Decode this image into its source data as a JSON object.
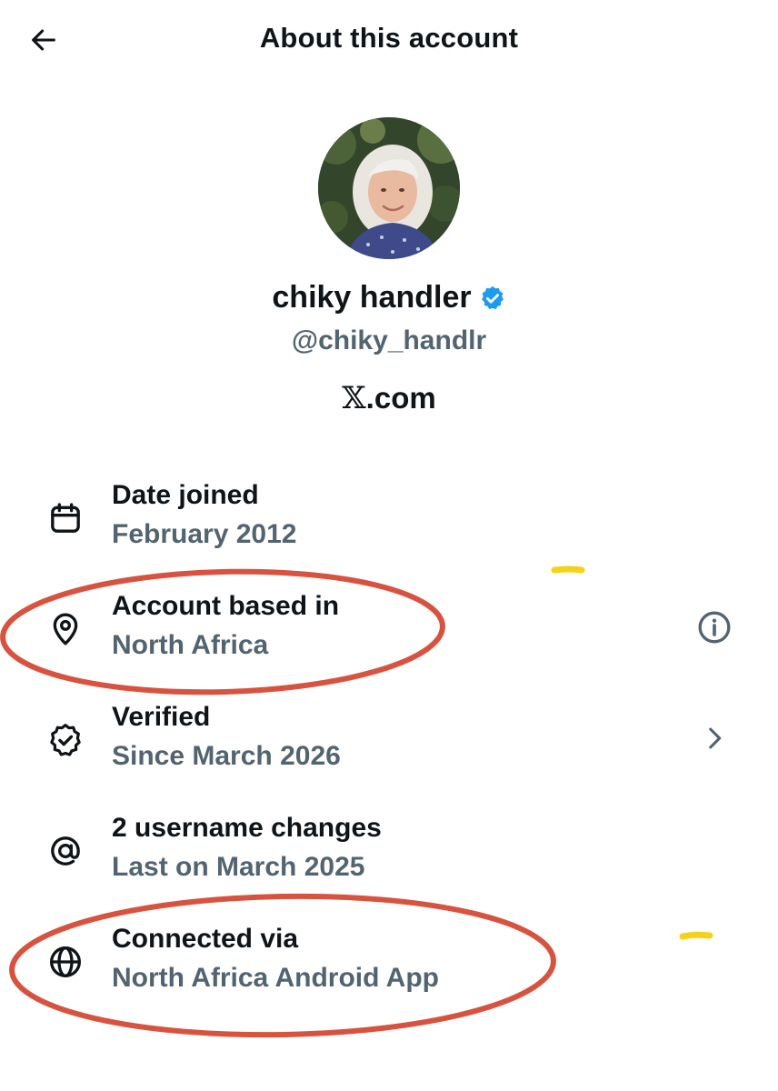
{
  "header": {
    "title": "About this account",
    "back_icon": "arrow-left-icon"
  },
  "profile": {
    "display_name": "chiky handler",
    "verified_badge_icon": "verified-badge-icon",
    "verified_color": "#1d9bf0",
    "handle": "@chiky_handlr",
    "site_logo": "𝕏",
    "site_suffix": ".com"
  },
  "rows": [
    {
      "icon": "calendar-icon",
      "label": "Date joined",
      "value": "February 2012",
      "trailing": null
    },
    {
      "icon": "location-pin-icon",
      "label": "Account based in",
      "value": "North Africa",
      "trailing": "info-icon"
    },
    {
      "icon": "verified-check-icon",
      "label": "Verified",
      "value": "Since March 2026",
      "trailing": "chevron-right-icon"
    },
    {
      "icon": "at-sign-icon",
      "label": "2 username changes",
      "value": "Last on March 2025",
      "trailing": null
    },
    {
      "icon": "globe-icon",
      "label": "Connected via",
      "value": "North Africa Android App",
      "trailing": null
    }
  ],
  "colors": {
    "primary_text": "#0f1419",
    "secondary_text": "#536471",
    "annotation_circle": "#d8533f",
    "highlight_mark": "#f5d21a"
  }
}
